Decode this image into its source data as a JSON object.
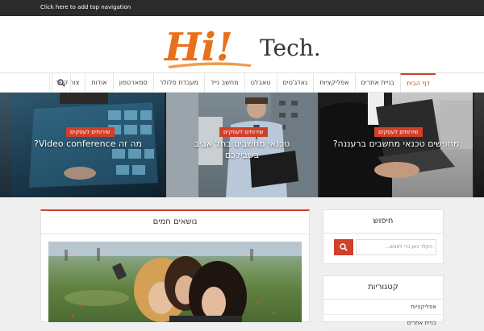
{
  "topbar": {
    "link_text": "Click here to add top navigation"
  },
  "logo": {
    "hi_text": "Hi!",
    "tech_text": "Tech."
  },
  "nav": {
    "items": [
      {
        "label": "דף הבית",
        "active": true
      },
      {
        "label": "בניית אתרים"
      },
      {
        "label": "אפליקציות"
      },
      {
        "label": "גאדג'טים"
      },
      {
        "label": "טאבלט"
      },
      {
        "label": "מחשב נייד"
      },
      {
        "label": "מעבדת סלולר"
      },
      {
        "label": "סמארטפון"
      },
      {
        "label": "אודות"
      },
      {
        "label": "צור קשר"
      }
    ],
    "search_icon": "search-icon"
  },
  "slider": {
    "slides": [
      {
        "badge": "שירותים לעסקים",
        "title": "מה זה Video conference?"
      },
      {
        "badge": "שירותים לעסקים",
        "title_line1": "טכנאי מחשבים בתל אביב",
        "title_line2": "בשבילכם"
      },
      {
        "badge": "שירותים לעסקים",
        "title": "מחפשים טכנאי מחשבים ברעננה?"
      }
    ]
  },
  "main": {
    "hot_topics_title": "נושאים חמים"
  },
  "sidebar": {
    "search": {
      "title": "חיפוש",
      "placeholder": "הקלד כאן כדי לחפש...",
      "button_icon": "search-icon"
    },
    "categories": {
      "title": "קטגוריות",
      "items": [
        "אפליקציות",
        "בניית אתרים"
      ]
    }
  },
  "colors": {
    "accent": "#d0402a",
    "logo_orange": "#e8701a",
    "topbar": "#2b2b2b"
  }
}
